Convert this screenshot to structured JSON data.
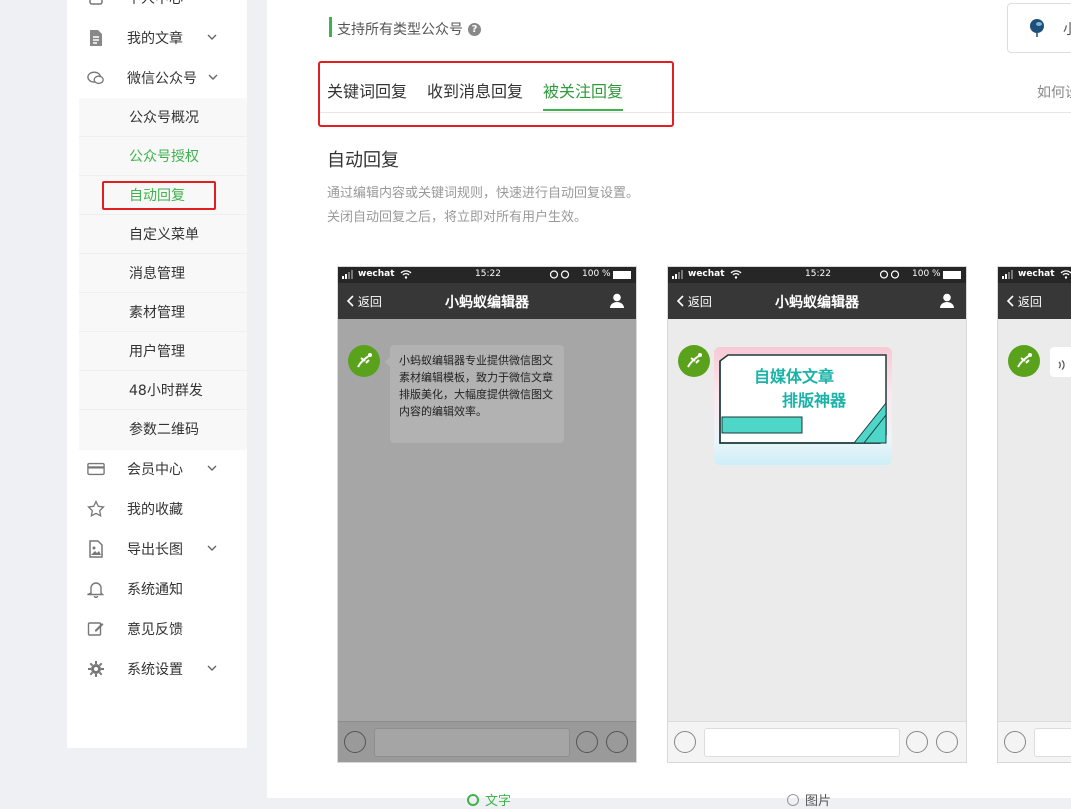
{
  "sidebar": {
    "top_partial": "个人中心",
    "items": [
      {
        "label": "我的文章",
        "icon": "document-icon"
      },
      {
        "label": "微信公众号",
        "icon": "chat-bubbles-icon"
      },
      {
        "label": "会员中心",
        "icon": "card-icon"
      },
      {
        "label": "我的收藏",
        "icon": "star-icon"
      },
      {
        "label": "导出长图",
        "icon": "image-icon"
      },
      {
        "label": "系统通知",
        "icon": "bell-icon"
      },
      {
        "label": "意见反馈",
        "icon": "edit-icon"
      },
      {
        "label": "系统设置",
        "icon": "gear-icon"
      }
    ],
    "sub_items": [
      {
        "label": "公众号概况"
      },
      {
        "label": "公众号授权"
      },
      {
        "label": "自动回复"
      },
      {
        "label": "自定义菜单"
      },
      {
        "label": "消息管理"
      },
      {
        "label": "素材管理"
      },
      {
        "label": "用户管理"
      },
      {
        "label": "48小时群发"
      },
      {
        "label": "参数二维码"
      }
    ]
  },
  "header": {
    "support_note": "支持所有类型公众号",
    "account_partial": "小",
    "help_partial": "如何设"
  },
  "tabs": [
    {
      "label": "关键词回复"
    },
    {
      "label": "收到消息回复"
    },
    {
      "label": "被关注回复"
    }
  ],
  "section": {
    "title": "自动回复",
    "desc_line1": "通过编辑内容或关键词规则，快速进行自动回复设置。",
    "desc_line2": "关闭自动回复之后，将立即对所有用户生效。"
  },
  "phone": {
    "carrier": "wechat",
    "time": "15:22",
    "battery": "100 %",
    "back": "返回",
    "title": "小蚂蚁编辑器"
  },
  "preview1": {
    "message": "小蚂蚁编辑器专业提供微信图文素材编辑模板，致力于微信文章排版美化，大幅度提供微信图文内容的编辑效率。"
  },
  "preview2": {
    "banner_line1": "自媒体文章",
    "banner_line2": "排版神器"
  },
  "options": {
    "text": "文字",
    "image": "图片"
  },
  "colors": {
    "accent": "#3cb34b",
    "highlight_box": "#e02020",
    "phone_header": "#373737",
    "avatar": "#5aa21c"
  }
}
